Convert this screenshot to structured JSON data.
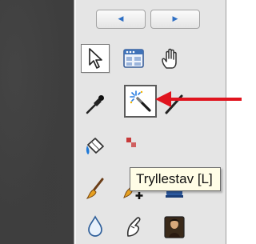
{
  "tooltip": {
    "text": "Tryllestav [L]"
  },
  "nav": {
    "prev_icon": "triangle-left-icon",
    "next_icon": "triangle-right-icon",
    "prev_glyph": "◀",
    "next_glyph": "▶"
  },
  "tools": [
    {
      "name": "move-tool",
      "icon": "arrow-cursor-icon",
      "selected": false
    },
    {
      "name": "layout-tool",
      "icon": "layout-grid-icon",
      "selected": false
    },
    {
      "name": "hand-tool",
      "icon": "hand-icon",
      "selected": false
    },
    {
      "name": "eyedropper-tool",
      "icon": "eyedropper-icon",
      "selected": false
    },
    {
      "name": "magic-wand-tool",
      "icon": "magic-wand-icon",
      "selected": true
    },
    {
      "name": "line-tool",
      "icon": "line-icon",
      "selected": false
    },
    {
      "name": "fill-tool",
      "icon": "paint-bucket-icon",
      "selected": false
    },
    {
      "name": "brush-tool",
      "icon": "brush-icon",
      "selected": false
    },
    {
      "name": "brush-plus-tool",
      "icon": "brush-plus-icon",
      "selected": false
    },
    {
      "name": "stamp-tool",
      "icon": "stamp-icon",
      "selected": false
    },
    {
      "name": "drop-tool",
      "icon": "drop-icon",
      "selected": false
    },
    {
      "name": "smudge-tool",
      "icon": "smudge-icon",
      "selected": false
    },
    {
      "name": "portrait-tool",
      "icon": "portrait-icon",
      "selected": false
    }
  ],
  "annotation": {
    "icon": "red-arrow-icon",
    "color": "#e0141e"
  },
  "colors": {
    "canvas": "#3e3e3e",
    "panel": "#e5e5e5",
    "accent": "#2e6fc4"
  }
}
